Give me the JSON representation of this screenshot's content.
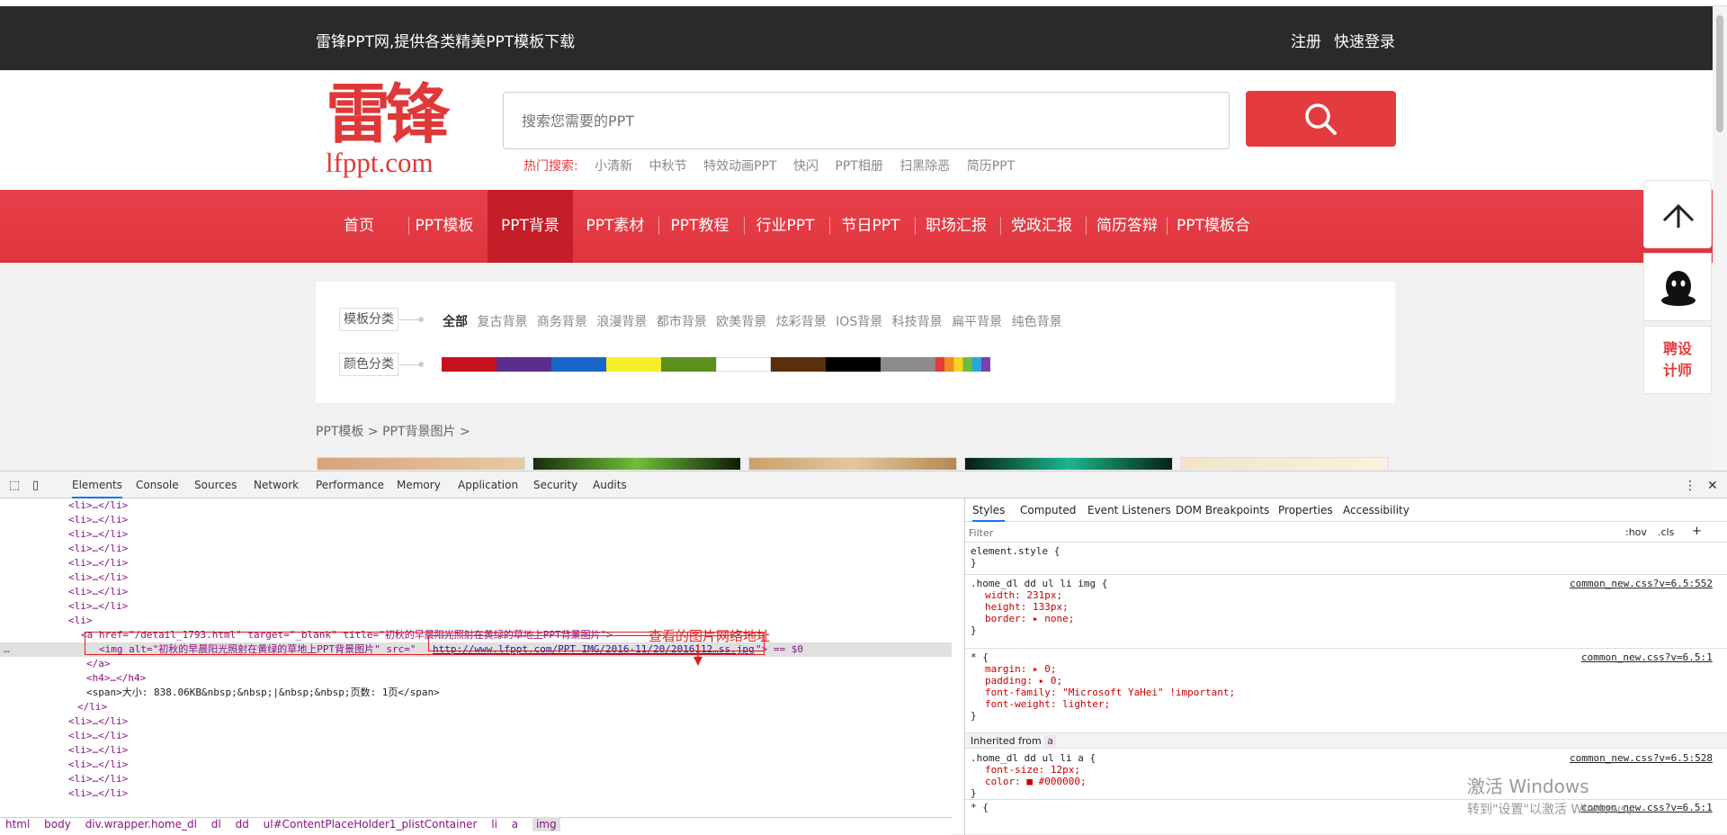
{
  "site": {
    "slogan": "雷锋PPT网,提供各类精美PPT模板下载",
    "register": "注册",
    "login": "快速登录",
    "logo_cn": "雷锋",
    "logo_en": "lfppt.com",
    "search_placeholder": "搜索您需要的PPT",
    "hot_label": "热门搜索:",
    "hot_keywords": [
      "小清新",
      "中秋节",
      "特效动画PPT",
      "快闪",
      "PPT相册",
      "扫黑除恶",
      "简历PPT"
    ],
    "nav": [
      "首页",
      "PPT模板",
      "PPT背景",
      "PPT素材",
      "PPT教程",
      "行业PPT",
      "节日PPT",
      "职场汇报",
      "党政汇报",
      "简历答辩",
      "PPT模板合集"
    ],
    "nav_active": "PPT背景",
    "filter_label": "模板分类",
    "filter_items": [
      "全部",
      "复古背景",
      "商务背景",
      "浪漫背景",
      "都市背景",
      "欧美背景",
      "炫彩背景",
      "IOS背景",
      "科技背景",
      "扁平背景",
      "纯色背景"
    ],
    "color_label": "颜色分类",
    "colors": [
      "#c8111c",
      "#5a2c8c",
      "#1766c8",
      "#f6ee2c",
      "#5c8f1c",
      "#ffffff",
      "#5a2f0c",
      "#000000",
      "#8c8c8c"
    ],
    "rainbow": [
      "#e33b3b",
      "#f08a24",
      "#f5d328",
      "#6cbf3c",
      "#2aa7d8",
      "#7b3fb0"
    ],
    "breadcrumb": "PPT模板 > PPT背景图片 >",
    "side_buttons": {
      "top_icon": "arrow-up-icon",
      "qq_icon": "qq-penguin-icon",
      "hire": "聘设\n计师",
      "hire_line1": "聘设",
      "hire_line2": "计师"
    }
  },
  "devtools": {
    "tabs": [
      "Elements",
      "Console",
      "Sources",
      "Network",
      "Performance",
      "Memory",
      "Application",
      "Security",
      "Audits"
    ],
    "active_tab": "Elements",
    "styles_tabs": [
      "Styles",
      "Computed",
      "Event Listeners",
      "DOM Breakpoints",
      "Properties",
      "Accessibility"
    ],
    "filter_placeholder": "Filter",
    "hov": ":hov",
    "cls": ".cls",
    "li_collapsed": "<li>…</li>",
    "li_open": "<li>",
    "li_close": "</li>",
    "a_tag": "<a href=\"/detail_1793.html\" target=\"_blank\" title=\"初秋的早晨阳光照射在黄绿的草地上PPT背景图片\">",
    "img_tag_start": "<img alt=\"初秋的早晨阳光照射在黄绿的草地上PPT背景图片\" src=\"",
    "img_src": "http://www.lfppt.com/PPT_IMG/2016-11/20/2016112…ss.jpg",
    "img_tag_end": "\"> == $0",
    "a_close": "</a>",
    "h4": "<h4>…</h4>",
    "span_row": "<span>大小: 838.06KB&nbsp;&nbsp;|&nbsp;&nbsp;页数: 1页</span>",
    "annotation": "查看的图片网络地址",
    "breadcrumbs": [
      "html",
      "body",
      "div.wrapper.home_dl",
      "dl",
      "dd",
      "ul#ContentPlaceHolder1_plistContainer",
      "li",
      "a",
      "img"
    ],
    "element_style": "element.style {",
    "rule1_sel": ".home_dl dd ul li img {",
    "rule1_src": "common_new.css?v=6.5:552",
    "rule1_props": [
      "width: 231px;",
      "height: 133px;",
      "border: ▸ none;"
    ],
    "rule2_sel": "* {",
    "rule2_src": "common_new.css?v=6.5:1",
    "rule2_props": [
      "margin: ▸ 0;",
      "padding: ▸ 0;",
      "font-family: \"Microsoft YaHei\" !important;",
      "font-weight: lighter;"
    ],
    "inherited": "Inherited from",
    "inherited_tag": "a",
    "rule3_sel": ".home_dl dd ul li a {",
    "rule3_src": "common_new.css?v=6.5:528",
    "rule3_props": [
      "font-size: 12px;",
      "color: ■ #000000;"
    ],
    "rule4_sel": "* {",
    "rule4_src": "common_new.css?v=6.5:1",
    "close_brace": "}"
  },
  "watermark": {
    "line1": "激活 Windows",
    "line2": "转到\"设置\"以激活 Windows。"
  }
}
